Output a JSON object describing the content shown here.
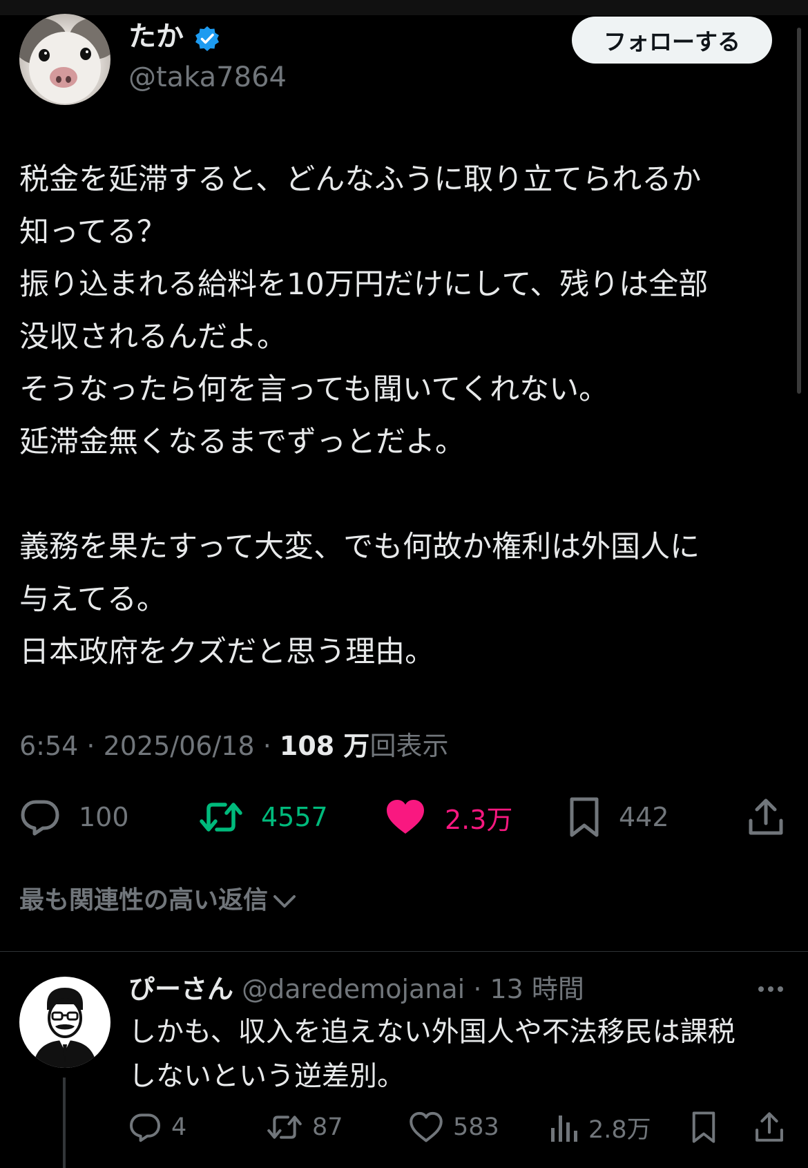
{
  "author": {
    "name": "たか",
    "handle": "@taka7864",
    "follow_label": "フォローする"
  },
  "tweet": {
    "paragraphs": [
      [
        "税金を延滞すると、どんなふうに取り立てられるか",
        "知ってる？",
        "振り込まれる給料を10万円だけにして、残りは全部",
        "没収されるんだよ。",
        "そうなったら何を言っても聞いてくれない。",
        "延滞金無くなるまでずっとだよ。"
      ],
      [
        "義務を果たすって大変、でも何故か権利は外国人に",
        "与えてる。",
        "日本政府をクズだと思う理由。"
      ]
    ],
    "time": "6:54",
    "date": "2025/06/18",
    "views_number": "108 万",
    "views_label": "回表示",
    "sep": " · "
  },
  "actions": {
    "replies": "100",
    "retweets": "4557",
    "likes": "2.3万",
    "bookmarks": "442"
  },
  "replies_filter": {
    "label": "最も関連性の高い返信"
  },
  "reply": {
    "name": "ぴーさん",
    "handle": "@daredemojanai",
    "time": "13 時間",
    "text_lines": [
      "しかも、収入を追えない外国人や不法移民は課税",
      "しないという逆差別。"
    ],
    "replies": "4",
    "retweets": "87",
    "likes": "583",
    "views": "2.8万"
  },
  "colors": {
    "background": "#000000",
    "text": "#e7e9ea",
    "muted": "#71767b",
    "verified": "#1d9bf0",
    "retweet": "#00ba7c",
    "like": "#f91880"
  }
}
